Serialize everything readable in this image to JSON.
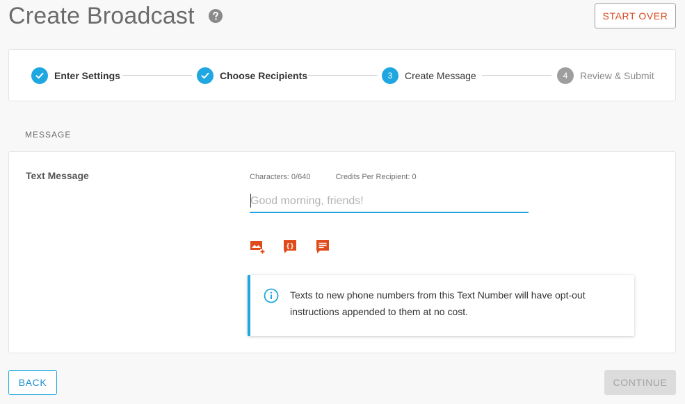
{
  "header": {
    "title": "Create Broadcast",
    "help_icon": "question-circle-icon",
    "start_over_label": "START OVER"
  },
  "stepper": {
    "steps": [
      {
        "label": "Enter Settings",
        "number": "1",
        "status": "done"
      },
      {
        "label": "Choose Recipients",
        "number": "2",
        "status": "done"
      },
      {
        "label": "Create Message",
        "number": "3",
        "status": "active"
      },
      {
        "label": "Review & Submit",
        "number": "4",
        "status": "pending"
      }
    ]
  },
  "section": {
    "label": "MESSAGE"
  },
  "message": {
    "field_label": "Text Message",
    "characters": "Characters: 0/640",
    "credits": "Credits Per Recipient: 0",
    "input_value": "",
    "placeholder": "Good morning, friends!",
    "tools": [
      "add-image-icon",
      "insert-variable-icon",
      "template-icon"
    ]
  },
  "info": {
    "icon": "info-circle-icon",
    "text": "Texts to new phone numbers from this Text Number will have opt-out instructions appended to them at no cost."
  },
  "footer": {
    "back_label": "BACK",
    "continue_label": "CONTINUE"
  },
  "colors": {
    "accent": "#1ea7e0",
    "danger": "#d84a1e",
    "tool_icon": "#e0491a",
    "pending_step": "#9e9e9e"
  }
}
